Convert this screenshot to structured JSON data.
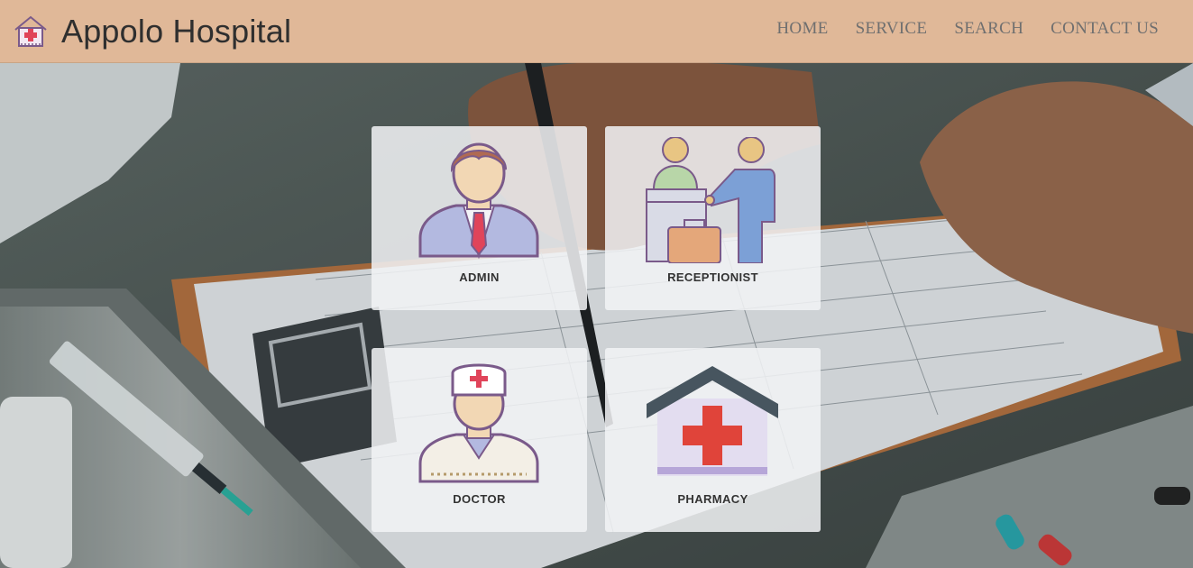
{
  "header": {
    "brand_name": "Appolo Hospital",
    "logo_icon": "hospital-house-icon",
    "bg_color": "#e0b898",
    "nav": [
      {
        "label": "HOME"
      },
      {
        "label": "SERVICE"
      },
      {
        "label": "SEARCH"
      },
      {
        "label": "CONTACT US"
      }
    ]
  },
  "hero": {
    "background_image": "doctor-writing-on-clipboard-photo"
  },
  "cards": [
    {
      "label": "ADMIN",
      "icon": "admin-businessman-icon"
    },
    {
      "label": "RECEPTIONIST",
      "icon": "receptionist-desk-icon"
    },
    {
      "label": "DOCTOR",
      "icon": "doctor-icon"
    },
    {
      "label": "PHARMACY",
      "icon": "pharmacy-building-icon"
    }
  ]
}
